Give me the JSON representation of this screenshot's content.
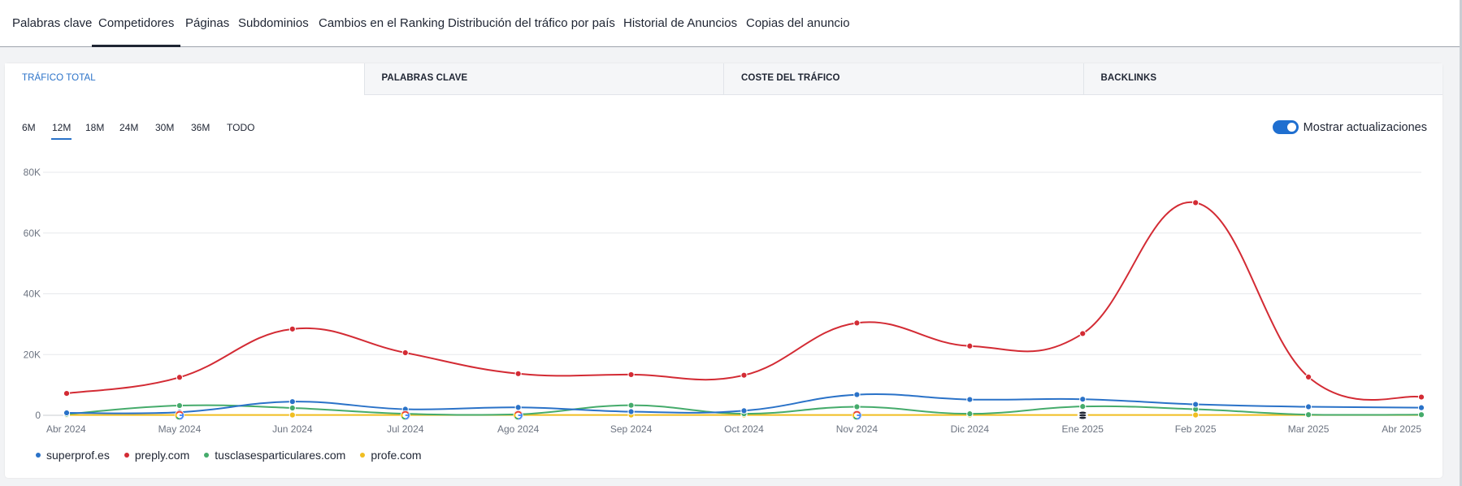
{
  "nav": {
    "tabs": [
      {
        "label": "Palabras clave",
        "active": false
      },
      {
        "label": "Competidores",
        "active": true
      },
      {
        "label": "Páginas",
        "active": false
      },
      {
        "label": "Subdominios",
        "active": false
      },
      {
        "label": "Cambios en el Ranking",
        "active": false
      },
      {
        "label": "Distribución del tráfico por país",
        "active": false
      },
      {
        "label": "Historial de Anuncios",
        "active": false
      },
      {
        "label": "Copias del anuncio",
        "active": false
      }
    ]
  },
  "metric_tabs": [
    {
      "label": "TRÁFICO TOTAL",
      "active": true
    },
    {
      "label": "PALABRAS CLAVE",
      "active": false
    },
    {
      "label": "COSTE DEL TRÁFICO",
      "active": false
    },
    {
      "label": "BACKLINKS",
      "active": false
    }
  ],
  "ranges": [
    {
      "label": "6M",
      "active": false
    },
    {
      "label": "12M",
      "active": true
    },
    {
      "label": "18M",
      "active": false
    },
    {
      "label": "24M",
      "active": false
    },
    {
      "label": "30M",
      "active": false
    },
    {
      "label": "36M",
      "active": false
    },
    {
      "label": "TODO",
      "active": false
    }
  ],
  "updates_toggle": {
    "label": "Mostrar actualizaciones",
    "on": true
  },
  "chart_data": {
    "type": "line",
    "x": [
      "Abr 2024",
      "May 2024",
      "Jun 2024",
      "Jul 2024",
      "Ago 2024",
      "Sep 2024",
      "Oct 2024",
      "Nov 2024",
      "Dic 2024",
      "Ene 2025",
      "Feb 2025",
      "Mar 2025",
      "Abr 2025"
    ],
    "y_ticks": [
      "0",
      "20K",
      "40K",
      "60K",
      "80K"
    ],
    "ylim": [
      0,
      80000
    ],
    "grid": true,
    "legend_position": "bottom-left",
    "series": [
      {
        "name": "superprof.es",
        "color": "#2a72c8",
        "values": [
          800,
          1000,
          4500,
          2000,
          2600,
          1200,
          1500,
          6800,
          5200,
          5300,
          3600,
          2800,
          2500
        ]
      },
      {
        "name": "preply.com",
        "color": "#d32b34",
        "values": [
          7200,
          12500,
          28400,
          20600,
          13700,
          13400,
          13200,
          30400,
          22800,
          26900,
          70000,
          12600,
          6000
        ]
      },
      {
        "name": "tusclasesparticulares.com",
        "color": "#45ab6b",
        "values": [
          400,
          3200,
          2400,
          500,
          300,
          3300,
          500,
          2800,
          500,
          2900,
          2000,
          200,
          200
        ]
      },
      {
        "name": "profe.com",
        "color": "#f0be21",
        "values": [
          100,
          100,
          100,
          100,
          100,
          100,
          100,
          100,
          100,
          100,
          100,
          100,
          100
        ]
      }
    ],
    "markers": [
      {
        "x": "May 2024",
        "icon": "google-icon"
      },
      {
        "x": "Jul 2024",
        "icon": "google-icon"
      },
      {
        "x": "Ago 2024",
        "icon": "google-icon"
      },
      {
        "x": "Nov 2024",
        "icon": "google-icon"
      },
      {
        "x": "Ene 2025",
        "icon": "database-update-icon"
      }
    ]
  }
}
